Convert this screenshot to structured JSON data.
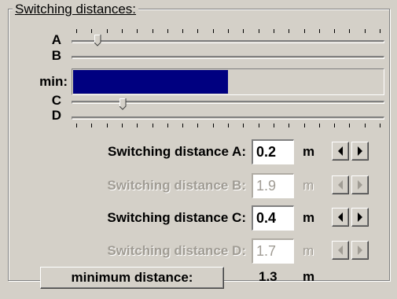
{
  "group": {
    "title": "Switching distances:"
  },
  "sliders": {
    "a_label": "A",
    "b_label": "B",
    "min_label": "min:",
    "c_label": "C",
    "d_label": "D"
  },
  "min_bar": {
    "fill_fraction": 0.5,
    "color": "#000080"
  },
  "fields": [
    {
      "label": "Switching distance A:",
      "value": "0.2",
      "unit": "m",
      "enabled": true
    },
    {
      "label": "Switching distance B:",
      "value": "1.9",
      "unit": "m",
      "enabled": false
    },
    {
      "label": "Switching distance C:",
      "value": "0.4",
      "unit": "m",
      "enabled": true
    },
    {
      "label": "Switching distance D:",
      "value": "1.7",
      "unit": "m",
      "enabled": false
    }
  ],
  "minimum": {
    "button_label": "minimum distance:",
    "value": "1.3",
    "unit": "m"
  },
  "icons": {
    "spin_left": "arrow-left-icon",
    "spin_right": "arrow-right-icon"
  }
}
